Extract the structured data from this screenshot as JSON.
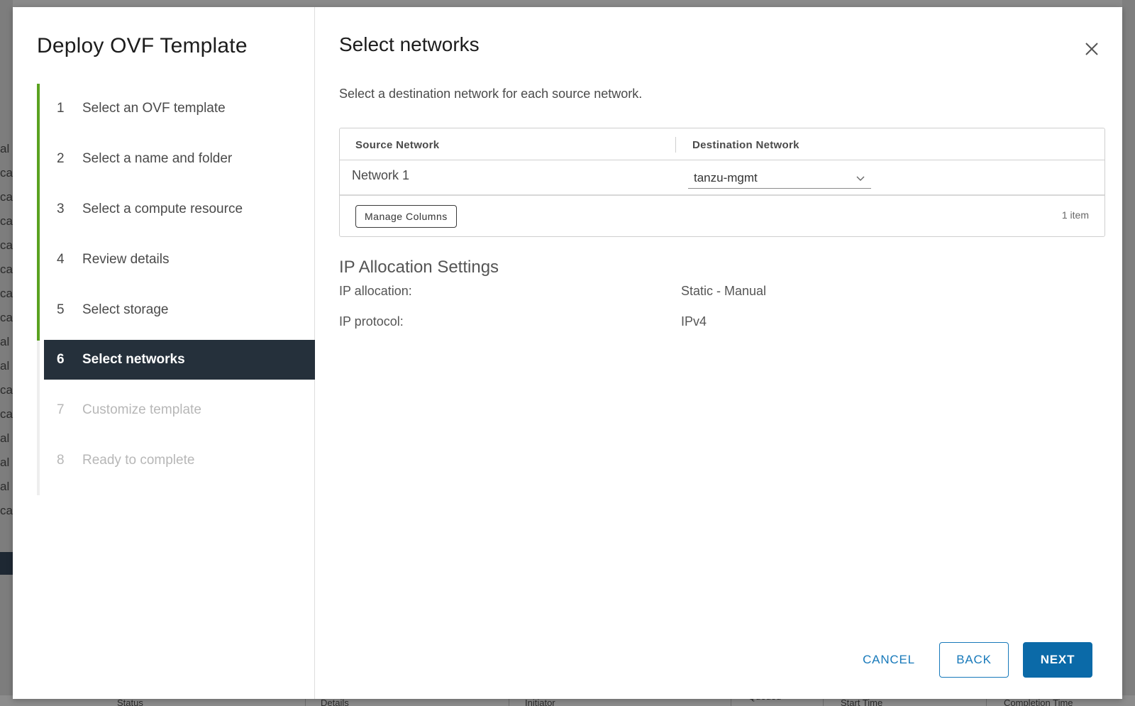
{
  "wizard": {
    "title": "Deploy OVF Template",
    "steps": [
      {
        "num": "1",
        "label": "Select an OVF template",
        "state": "done"
      },
      {
        "num": "2",
        "label": "Select a name and folder",
        "state": "done"
      },
      {
        "num": "3",
        "label": "Select a compute resource",
        "state": "done"
      },
      {
        "num": "4",
        "label": "Review details",
        "state": "done"
      },
      {
        "num": "5",
        "label": "Select storage",
        "state": "done"
      },
      {
        "num": "6",
        "label": "Select networks",
        "state": "active"
      },
      {
        "num": "7",
        "label": "Customize template",
        "state": "disabled"
      },
      {
        "num": "8",
        "label": "Ready to complete",
        "state": "disabled"
      }
    ]
  },
  "page": {
    "title": "Select networks",
    "instruction": "Select a destination network for each source network."
  },
  "network_grid": {
    "columns": [
      "Source Network",
      "Destination Network"
    ],
    "rows": [
      {
        "source": "Network 1",
        "destination": "tanzu-mgmt"
      }
    ],
    "manage_columns_label": "Manage Columns",
    "item_count": "1 item"
  },
  "ip_settings": {
    "title": "IP Allocation Settings",
    "allocation_label": "IP allocation:",
    "allocation_value": "Static - Manual",
    "protocol_label": "IP protocol:",
    "protocol_value": "IPv4"
  },
  "buttons": {
    "cancel": "CANCEL",
    "back": "BACK",
    "next": "NEXT"
  },
  "colors": {
    "accent": "#1779ba",
    "primary_button": "#0b6aa8",
    "active_step_bg": "#25303b",
    "progress_done": "#5aa220"
  },
  "background": {
    "left_fragments": [
      "al",
      "ca",
      "cal",
      "ca",
      "ca",
      "ca",
      "ca",
      "ca",
      "al",
      "al",
      "cal",
      "cal",
      "al",
      "al",
      "al",
      "cal",
      "al"
    ],
    "bottom_columns": [
      "Status",
      "Details",
      "Initiator",
      "Queued",
      "Start Time",
      "Completion Time"
    ]
  }
}
